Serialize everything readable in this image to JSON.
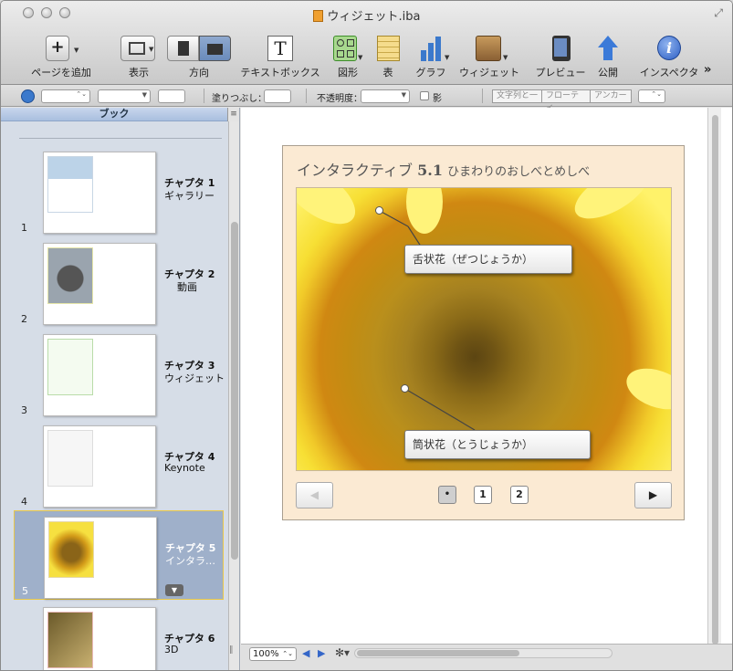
{
  "window": {
    "title": "ウィジェット.iba"
  },
  "toolbar": {
    "add_page": "ページを追加",
    "view": "表示",
    "orientation": "方向",
    "textbox": "テキストボックス",
    "shapes": "図形",
    "table": "表",
    "chart": "グラフ",
    "widgets": "ウィジェット",
    "preview": "プレビュー",
    "publish": "公開",
    "inspector": "インスペクタ",
    "more": "»"
  },
  "formatbar": {
    "fill_label": "塗りつぶし：",
    "opacity_label": "不透明度：",
    "shadow_label": "影",
    "wrap_inline": "文字列と一",
    "floating": "フローティ",
    "anchor": "アンカー"
  },
  "sidebar": {
    "header": "ブック",
    "collapse": "≡",
    "chapters": [
      {
        "num": "1",
        "title": "チャプタ 1",
        "subtitle": "ギャラリー"
      },
      {
        "num": "2",
        "title": "チャプタ 2",
        "subtitle": "動画"
      },
      {
        "num": "3",
        "title": "チャプタ 3",
        "subtitle": "ウィジェット"
      },
      {
        "num": "4",
        "title": "チャプタ 4",
        "subtitle": "Keynote"
      },
      {
        "num": "5",
        "title": "チャプタ 5",
        "subtitle": "インタラ…"
      },
      {
        "num": "6",
        "title": "チャプタ 6",
        "subtitle": "3D"
      }
    ]
  },
  "widget": {
    "title_prefix": "インタラクティブ",
    "title_num": "5.1",
    "title_sub": "ひまわりのおしべとめしべ",
    "callouts": [
      {
        "label": "舌状花（ぜつじょうか）"
      },
      {
        "label": "筒状花（とうじょうか）"
      }
    ],
    "pages": [
      "•",
      "1",
      "2"
    ],
    "prev": "◀",
    "next": "▶"
  },
  "bottombar": {
    "zoom": "100%",
    "zoom_arrows": "⌃⌄",
    "prev": "◀",
    "next": "▶",
    "action": "✻▾"
  }
}
